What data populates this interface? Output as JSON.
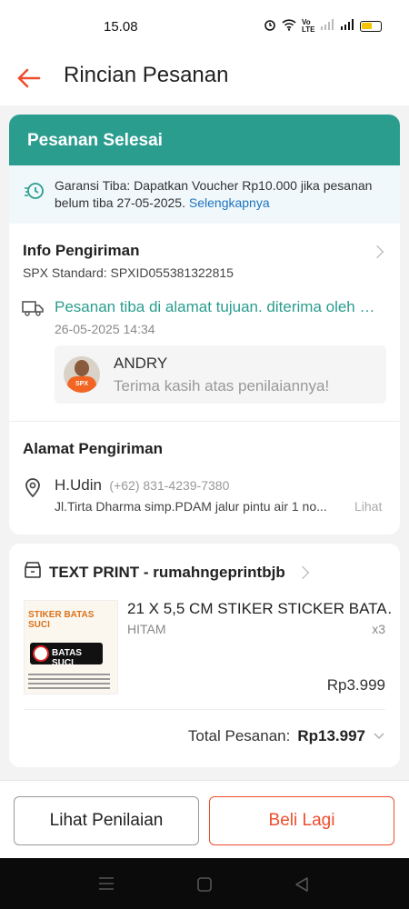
{
  "status_bar": {
    "time": "15.08",
    "network_label": "Vo LTE"
  },
  "app_bar": {
    "title": "Rincian Pesanan"
  },
  "order": {
    "status_banner": "Pesanan Selesai",
    "guarantee_text": "Garansi Tiba: Dapatkan Voucher Rp10.000 jika pesanan belum tiba 27-05-2025.",
    "guarantee_link": "Selengkapnya"
  },
  "shipping_info": {
    "heading": "Info Pengiriman",
    "service": "SPX Standard: SPXID055381322815",
    "tracking_status": "Pesanan tiba di alamat tujuan. diterima oleh …",
    "tracking_time": "26-05-2025 14:34",
    "courier_name": "ANDRY",
    "courier_message": "Terima kasih atas penilaiannya!"
  },
  "address": {
    "heading": "Alamat Pengiriman",
    "recipient": "H.Udin",
    "phone": "(+62) 831-4239-7380",
    "street": "Jl.Tirta Dharma simp.PDAM jalur pintu air 1 no...",
    "more_link": "Lihat"
  },
  "shop": {
    "name": "TEXT PRINT - rumahngeprintbjb",
    "product": {
      "title": "21 X 5,5 CM STIKER STICKER BATA…",
      "variant": "HITAM",
      "qty": "x3",
      "price": "Rp3.999",
      "image_title": "STIKER BATAS SUCI",
      "image_sign": "BATAS SUCI"
    },
    "total_label": "Total Pesanan:",
    "total_value": "Rp13.997"
  },
  "actions": {
    "review": "Lihat Penilaian",
    "buy_again": "Beli Lagi"
  },
  "colors": {
    "accent": "#ee4d2d",
    "teal": "#2a9d8f",
    "link": "#1e73be"
  }
}
